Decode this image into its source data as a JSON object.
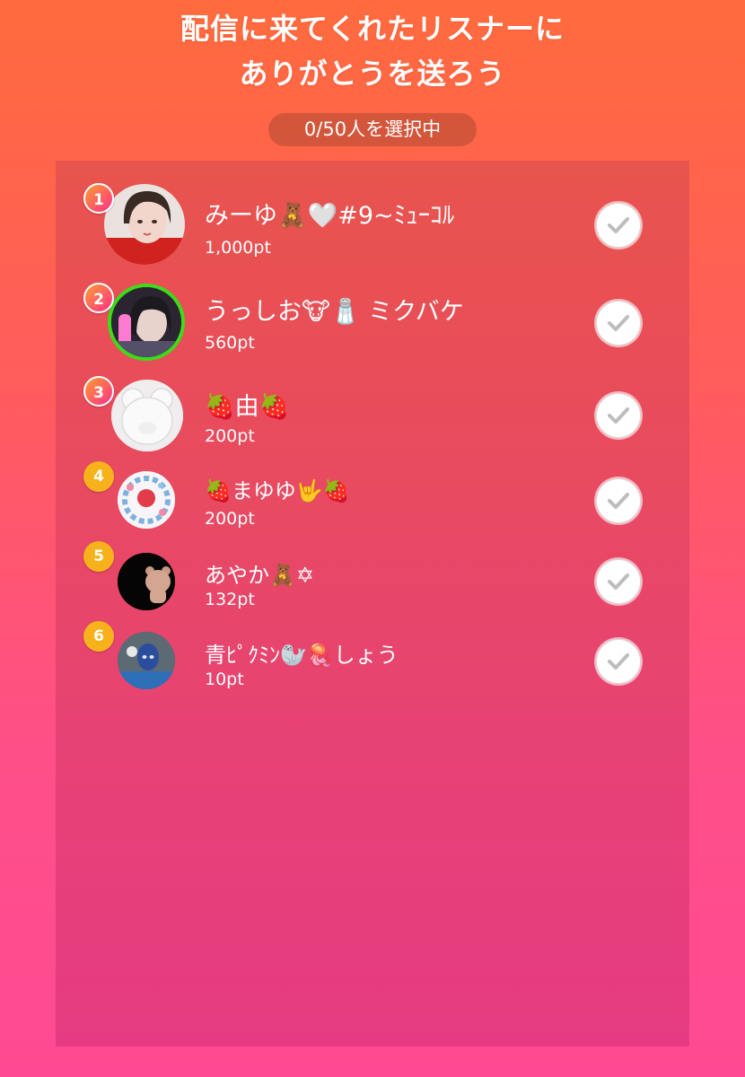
{
  "header": {
    "title_line1": "配信に来てくれたリスナーに",
    "title_line2": "ありがとうを送ろう",
    "counter": "0/50人を選択中"
  },
  "listeners": [
    {
      "rank": "1",
      "name": "みーゆ🧸🤍#9~ﾐｭｰｺﾙ",
      "points": "1,000pt"
    },
    {
      "rank": "2",
      "name": "うっしお🐮🧂 ミクバケ",
      "points": "560pt"
    },
    {
      "rank": "3",
      "name": "🍓由🍓",
      "points": "200pt"
    },
    {
      "rank": "4",
      "name": "🍓まゆゆ🤟🍓",
      "points": "200pt"
    },
    {
      "rank": "5",
      "name": "あやか🧸✡",
      "points": "132pt"
    },
    {
      "rank": "6",
      "name": "青ﾋﾟｸﾐﾝ🦭🪼しょう",
      "points": "10pt"
    }
  ],
  "colors": {
    "rank_top_gradient": [
      "#ff9d2f",
      "#ff2f8a"
    ],
    "rank_normal": "#f7b21b",
    "avatar2_ring": "#3ddc1a",
    "check_mark": "#bdbdbd"
  }
}
